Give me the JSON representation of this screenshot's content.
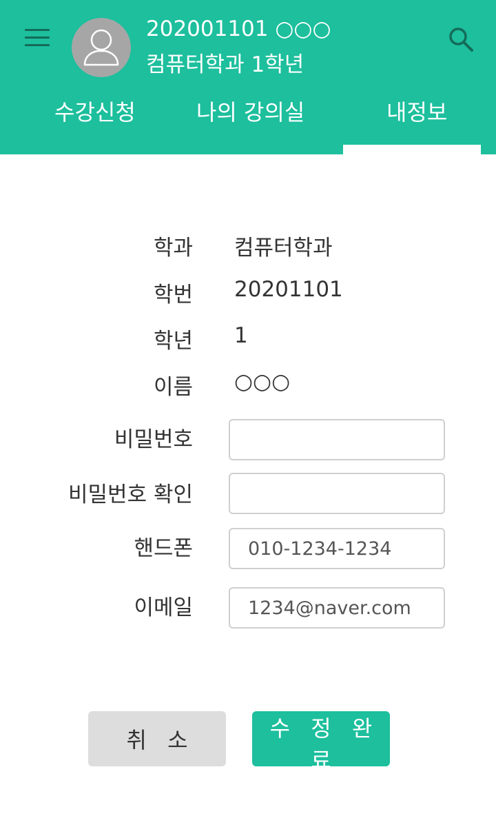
{
  "header": {
    "student_id_name": "202001101  ○○○",
    "department_year": "컴퓨터학과 1학년"
  },
  "tabs": [
    {
      "label": "수강신청"
    },
    {
      "label": "나의 강의실"
    },
    {
      "label": "내정보",
      "active": true
    }
  ],
  "profile": {
    "department": {
      "label": "학과",
      "value": "컴퓨터학과"
    },
    "student_number": {
      "label": "학번",
      "value": "20201101"
    },
    "grade": {
      "label": "학년",
      "value": "1"
    },
    "name": {
      "label": "이름",
      "value": "○○○"
    }
  },
  "form": {
    "password": {
      "label": "비밀번호",
      "value": ""
    },
    "password_confirm": {
      "label": "비밀번호 확인",
      "value": ""
    },
    "phone": {
      "label": "핸드폰",
      "value": "010-1234-1234"
    },
    "email": {
      "label": "이메일",
      "value": "1234@naver.com"
    }
  },
  "buttons": {
    "cancel": "취 소",
    "submit": "수 정 완 료"
  },
  "colors": {
    "accent": "#1dbf9d",
    "icon_dark": "#146b59",
    "cancel_bg": "#dddddd",
    "avatar_bg": "#a6a6a6"
  },
  "icons": {
    "menu": "hamburger-menu-icon",
    "avatar": "user-avatar-icon",
    "search": "search-icon"
  }
}
